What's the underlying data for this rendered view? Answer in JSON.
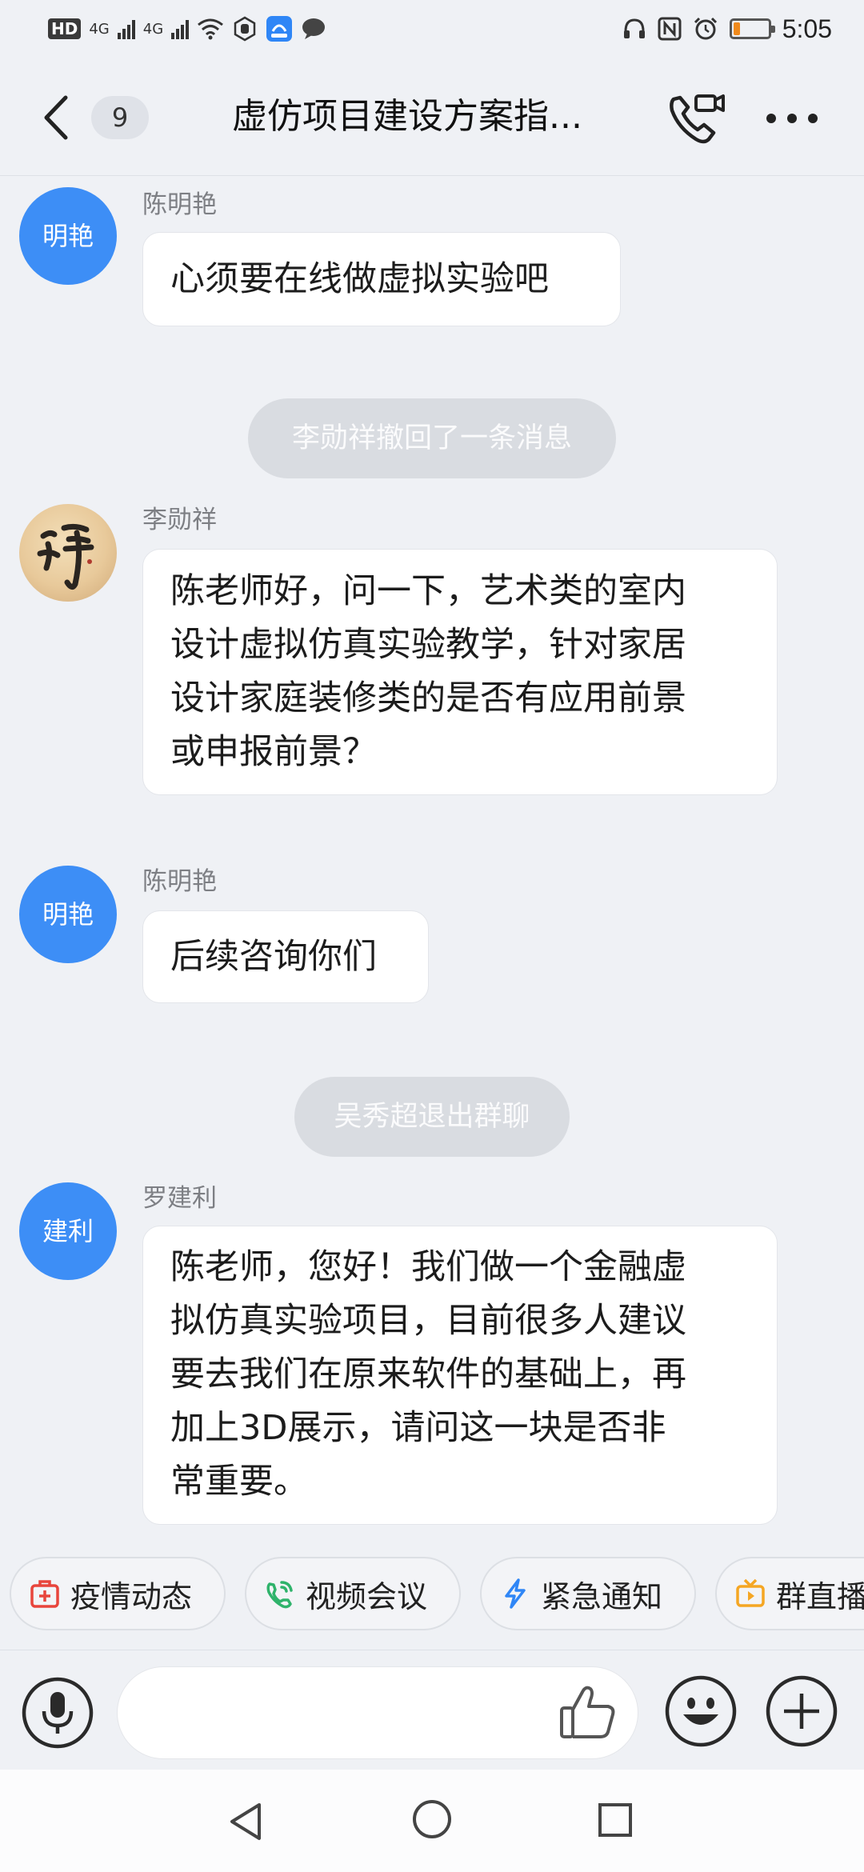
{
  "status_bar": {
    "hd": "HD",
    "net1": "4G",
    "net2": "4G",
    "time": "5:05",
    "battery_level": 0.2,
    "battery_color": "#f08a1c"
  },
  "header": {
    "unread_count": "9",
    "title": "虚仿项目建设方案指..."
  },
  "messages": [
    {
      "avatar": "明艳",
      "sender": "陈明艳",
      "text": "心须要在线做虚拟实验吧"
    },
    {
      "system": "李勋祥撤回了一条消息"
    },
    {
      "avatar_icon": "calligraphy-avatar",
      "sender": "李勋祥",
      "text": "陈老师好，问一下，艺术类的室内\n设计虚拟仿真实验教学，针对家居\n设计家庭装修类的是否有应用前景\n或申报前景？"
    },
    {
      "avatar": "明艳",
      "sender": "陈明艳",
      "text": "后续咨询你们"
    },
    {
      "system": "吴秀超退出群聊"
    },
    {
      "avatar": "建利",
      "sender": "罗建利",
      "text": "陈老师，您好！我们做一个金融虚\n拟仿真实验项目，目前很多人建议\n要去我们在原来软件的基础上，再\n加上3D展示，请问这一块是否非\n常重要。"
    }
  ],
  "quick_actions": [
    {
      "label": "疫情动态",
      "icon": "medical-kit-icon",
      "color": "#e8453c"
    },
    {
      "label": "视频会议",
      "icon": "video-call-icon",
      "color": "#2fb36b"
    },
    {
      "label": "紧急通知",
      "icon": "lightning-icon",
      "color": "#2f86f6"
    },
    {
      "label": "群直播",
      "icon": "tv-icon",
      "color": "#f5a623"
    }
  ],
  "colors": {
    "avatar_blue": "#3d8ef6",
    "background": "#eff1f5",
    "system_pill": "#d9dce1"
  }
}
